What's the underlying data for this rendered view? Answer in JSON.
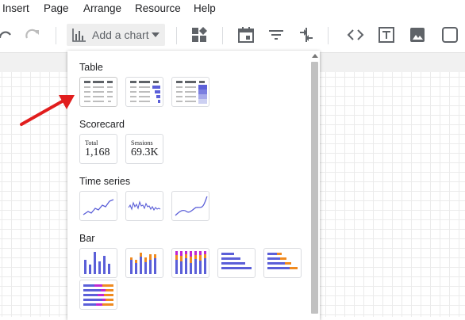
{
  "menu": [
    "Insert",
    "Page",
    "Arrange",
    "Resource",
    "Help"
  ],
  "toolbar": {
    "add_chart_label": "Add a chart",
    "icons": [
      "undo-icon",
      "redo-icon",
      "chart-icon",
      "add-component-icon",
      "calendar-icon",
      "filter-icon",
      "sort-icon",
      "code-icon",
      "text-box-icon",
      "image-icon",
      "shape-icon"
    ]
  },
  "panel": {
    "sections": {
      "table": "Table",
      "scorecard": "Scorecard",
      "timeseries": "Time series",
      "bar": "Bar"
    },
    "scorecards": [
      {
        "label": "Total",
        "value": "1,168"
      },
      {
        "label": "Sessions",
        "value": "69.3K"
      }
    ]
  },
  "colors": {
    "accent": "#5b5fd8",
    "orange": "#ef8a20",
    "magenta": "#c026d3",
    "arrow": "#e11d1d"
  }
}
